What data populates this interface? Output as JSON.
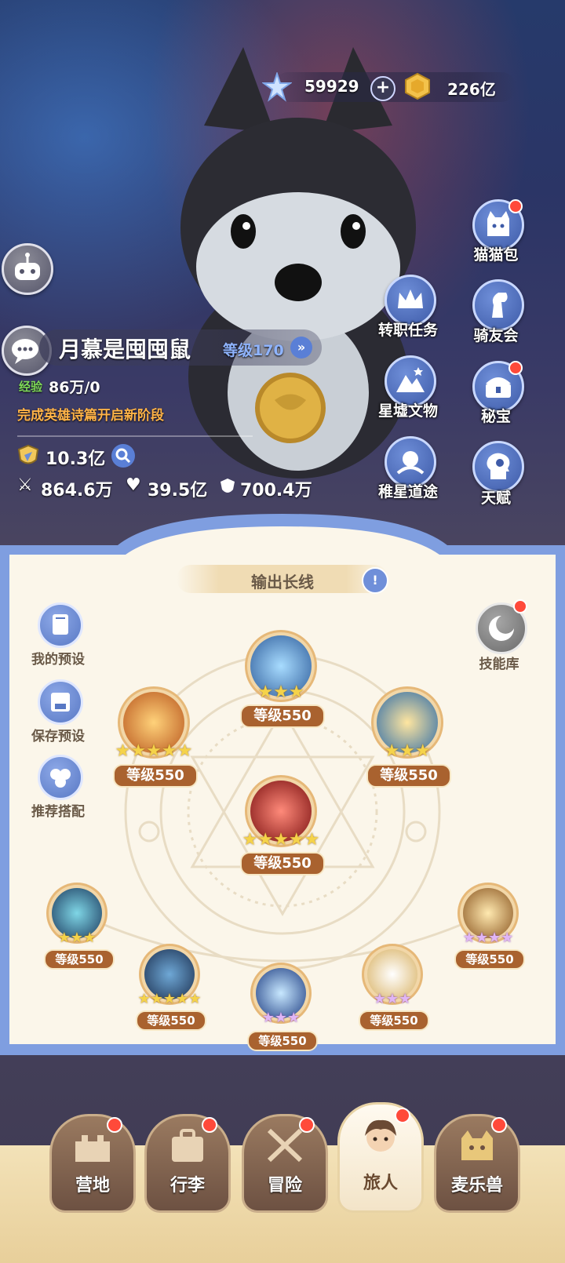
{
  "resources": {
    "stars": "59929",
    "gold": "226亿"
  },
  "player": {
    "name": "月慕是囤囤鼠",
    "level": "等级170",
    "exp_label": "经验",
    "exp_value": "86万/0",
    "quest_hint": "完成英雄诗篇开启新阶段",
    "power": "10.3亿",
    "attack": "864.6万",
    "hp": "39.5亿",
    "defense": "700.4万"
  },
  "right_menu": [
    {
      "label": "猫猫包",
      "icon": "cat-bag-icon",
      "badge": true
    },
    {
      "label": "转职任务",
      "icon": "crown-icon",
      "badge": false
    },
    {
      "label": "骑友会",
      "icon": "horse-icon",
      "badge": false
    },
    {
      "label": "星墟文物",
      "icon": "ruins-icon",
      "badge": false
    },
    {
      "label": "秘宝",
      "icon": "treasure-icon",
      "badge": true
    },
    {
      "label": "稚星道途",
      "icon": "star-path-icon",
      "badge": false
    },
    {
      "label": "天赋",
      "icon": "talent-icon",
      "badge": false
    }
  ],
  "skill_panel": {
    "build_name": "输出长线",
    "side_buttons": [
      "我的预设",
      "保存预设",
      "推荐搭配"
    ],
    "library_label": "技能库",
    "skills": [
      {
        "level": "等级550",
        "stars": 3,
        "star_type": "gold"
      },
      {
        "level": "等级550",
        "stars": 5,
        "star_type": "gold"
      },
      {
        "level": "等级550",
        "stars": 3,
        "star_type": "gold"
      },
      {
        "level": "等级550",
        "stars": 5,
        "star_type": "gold"
      },
      {
        "level": "等级550",
        "stars": 3,
        "star_type": "gold"
      },
      {
        "level": "等级550",
        "stars": 5,
        "star_type": "gold"
      },
      {
        "level": "等级550",
        "stars": 3,
        "star_type": "purple"
      },
      {
        "level": "等级550",
        "stars": 3,
        "star_type": "purple"
      },
      {
        "level": "等级550",
        "stars": 4,
        "star_type": "purple"
      }
    ]
  },
  "nav": [
    {
      "label": "营地",
      "badge": true
    },
    {
      "label": "行李",
      "badge": true
    },
    {
      "label": "冒险",
      "badge": true
    },
    {
      "label": "旅人",
      "badge": true,
      "active": true
    },
    {
      "label": "麦乐兽",
      "badge": true
    }
  ],
  "colors": {
    "accent": "#a9622f",
    "badge": "#ff4a3a",
    "panel_bg": "#fbf6ea",
    "panel_frame": "#6f8fd9"
  }
}
